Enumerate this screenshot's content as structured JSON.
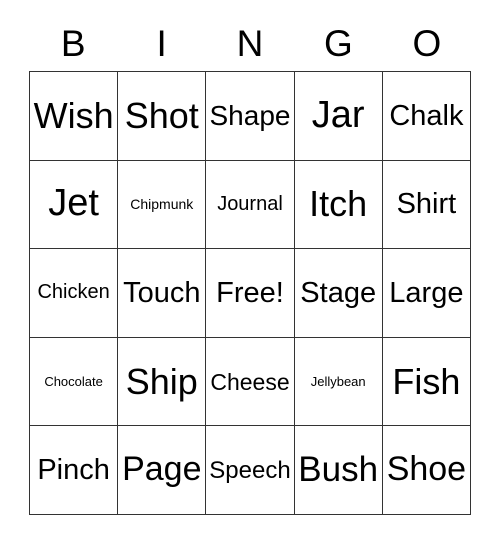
{
  "card": {
    "title": "BINGO Card",
    "header_letters": [
      "B",
      "I",
      "N",
      "G",
      "O"
    ],
    "free_space_label": "Free!",
    "colors": {
      "background": "#ffffff",
      "border": "#333333",
      "text": "#000000"
    },
    "grid": {
      "rows": 5,
      "columns": 5,
      "cells": [
        [
          {
            "text": "Wish"
          },
          {
            "text": "Shot"
          },
          {
            "text": "Shape"
          },
          {
            "text": "Jar"
          },
          {
            "text": "Chalk"
          }
        ],
        [
          {
            "text": "Jet"
          },
          {
            "text": "Chipmunk"
          },
          {
            "text": "Journal"
          },
          {
            "text": "Itch"
          },
          {
            "text": "Shirt"
          }
        ],
        [
          {
            "text": "Chicken"
          },
          {
            "text": "Touch"
          },
          {
            "text": "Free!"
          },
          {
            "text": "Stage"
          },
          {
            "text": "Large"
          }
        ],
        [
          {
            "text": "Chocolate"
          },
          {
            "text": "Ship"
          },
          {
            "text": "Cheese"
          },
          {
            "text": "Jellybean"
          },
          {
            "text": "Fish"
          }
        ],
        [
          {
            "text": "Pinch"
          },
          {
            "text": "Page"
          },
          {
            "text": "Speech"
          },
          {
            "text": "Bush"
          },
          {
            "text": "Shoe"
          }
        ]
      ]
    }
  }
}
